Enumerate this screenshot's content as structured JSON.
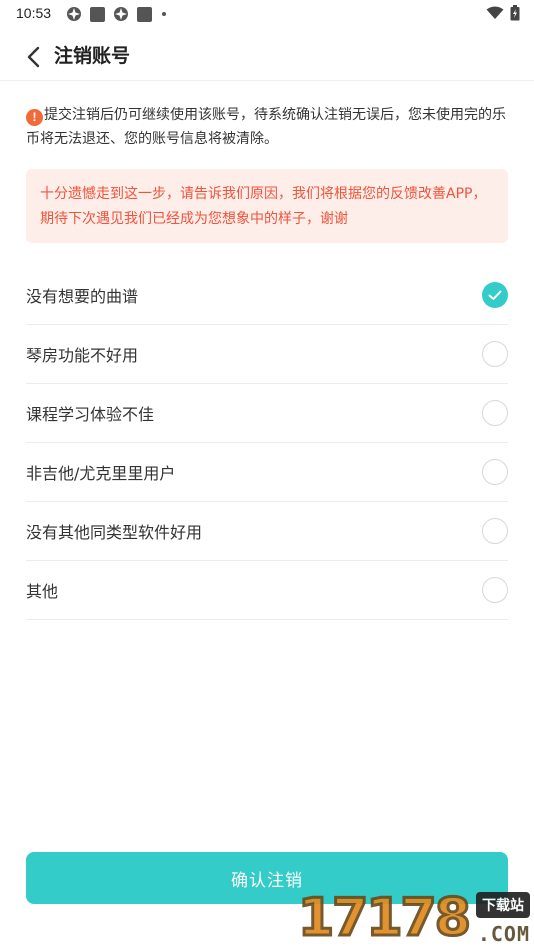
{
  "status_bar": {
    "time": "10:53"
  },
  "header": {
    "title": "注销账号"
  },
  "notice": {
    "text": "提交注销后仍可继续使用该账号，待系统确认注销无误后，您未使用完的乐币将无法退还、您的账号信息将被清除。"
  },
  "regret_box": {
    "text": "十分遗憾走到这一步，请告诉我们原因，我们将根据您的反馈改善APP，期待下次遇见我们已经成为您想象中的样子，谢谢"
  },
  "reasons": [
    {
      "label": "没有想要的曲谱",
      "checked": true
    },
    {
      "label": "琴房功能不好用",
      "checked": false
    },
    {
      "label": "课程学习体验不佳",
      "checked": false
    },
    {
      "label": "非吉他/尤克里里用户",
      "checked": false
    },
    {
      "label": "没有其他同类型软件好用",
      "checked": false
    },
    {
      "label": "其他",
      "checked": false
    }
  ],
  "confirm_button": {
    "label": "确认注销"
  },
  "watermark": {
    "digits": "17178",
    "tag": "下载站",
    "domain": ".COM"
  },
  "colors": {
    "accent": "#33ccc8",
    "warning": "#f06a3a",
    "regret_text": "#f0543a",
    "regret_bg": "#fdeeea"
  }
}
